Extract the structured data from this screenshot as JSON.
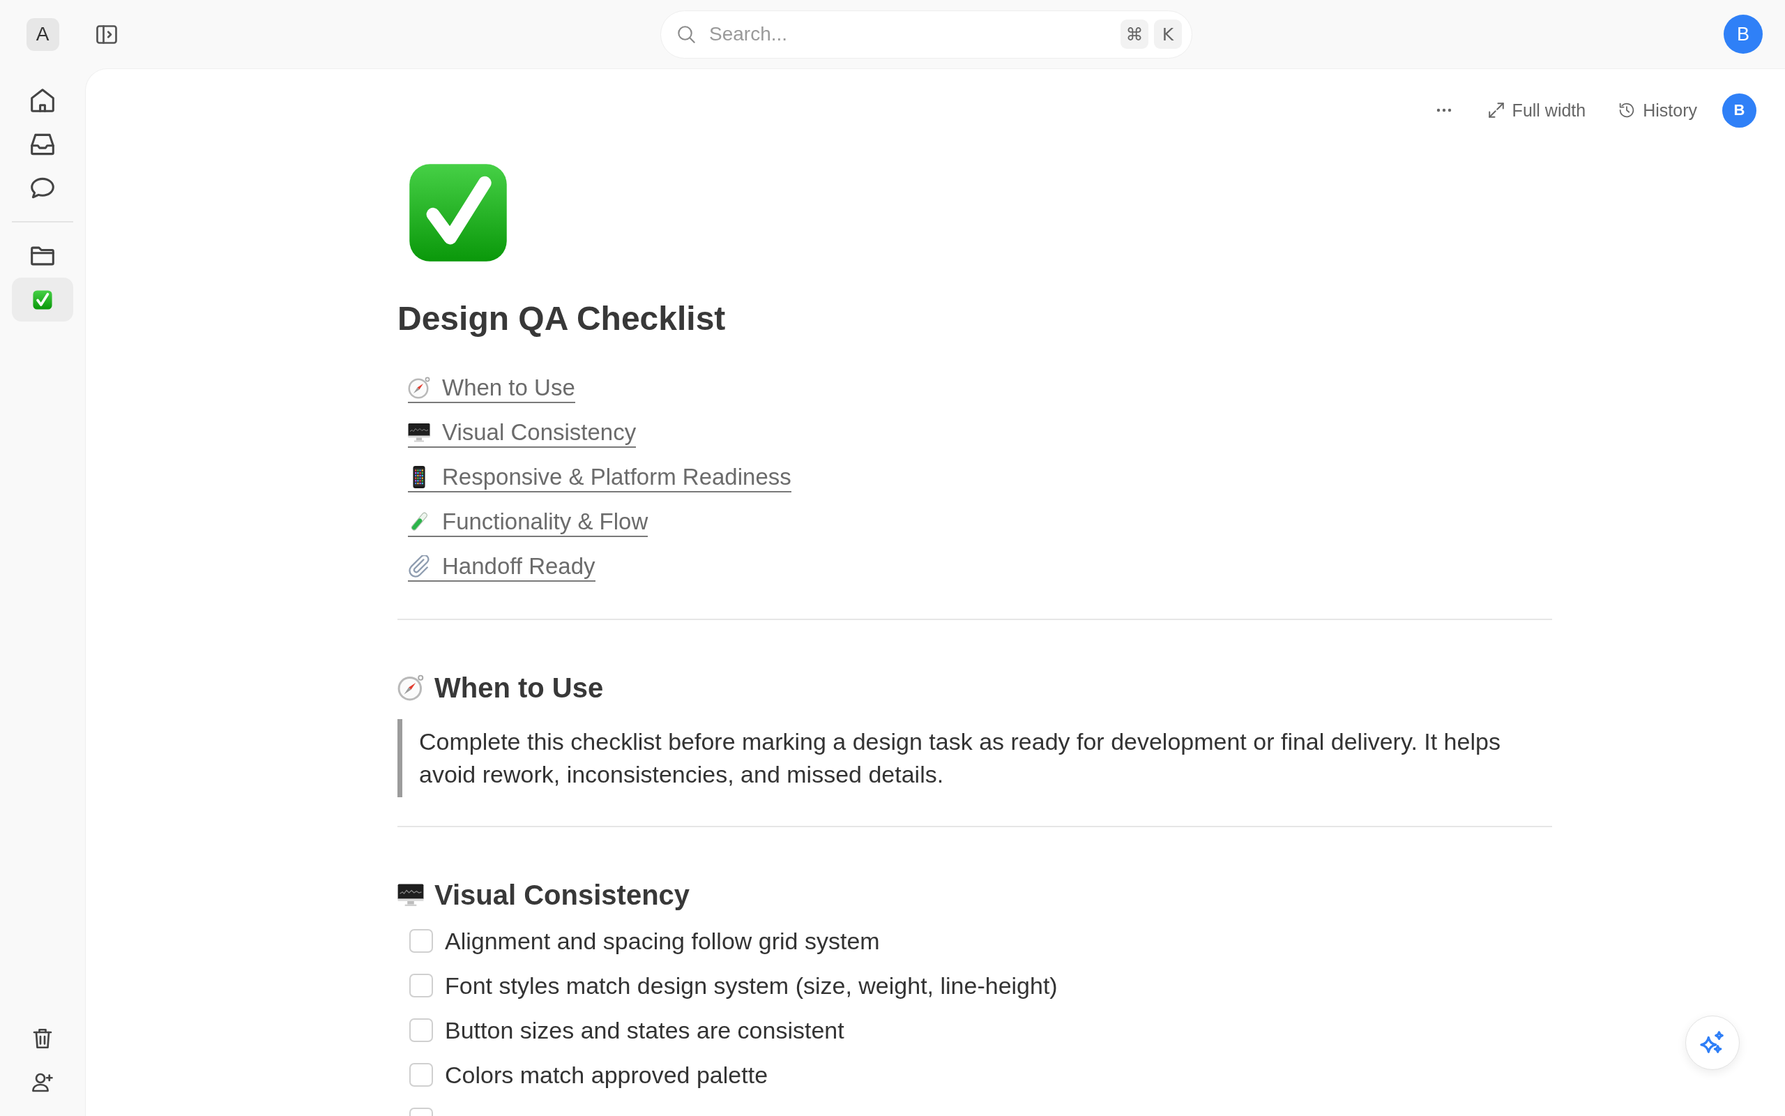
{
  "topbar": {
    "workspace": "A",
    "search": {
      "placeholder": "Search...",
      "shortcut": [
        "⌘",
        "K"
      ]
    },
    "avatar": "B"
  },
  "sidebar": {
    "primary": [
      {
        "selected": false
      },
      {
        "selected": false
      },
      {
        "selected": false
      }
    ],
    "secondary": [
      {
        "selected": false
      },
      {
        "selected": true
      }
    ]
  },
  "toolbar": {
    "buttons": [
      "Full width",
      "History"
    ],
    "avatar": "B"
  },
  "page": {
    "title": "Design QA Checklist",
    "toc": [
      "When to Use",
      "Visual Consistency",
      "Responsive & Platform Readiness",
      "Functionality & Flow",
      "Handoff Ready"
    ],
    "sections": [
      {
        "kind": "quote",
        "heading": "When to Use",
        "text": "Complete this checklist before marking a design task as ready for development or final delivery. It helps avoid rework, inconsistencies, and missed details."
      },
      {
        "kind": "checklist",
        "heading": "Visual Consistency",
        "items": [
          {
            "label": "Alignment and spacing follow grid system",
            "checked": false
          },
          {
            "label": "Font styles match design system (size, weight, line-height)",
            "checked": false
          },
          {
            "label": "Button sizes and states are consistent",
            "checked": false
          },
          {
            "label": "Colors match approved palette",
            "checked": false
          },
          {
            "checked": false
          }
        ]
      }
    ]
  }
}
